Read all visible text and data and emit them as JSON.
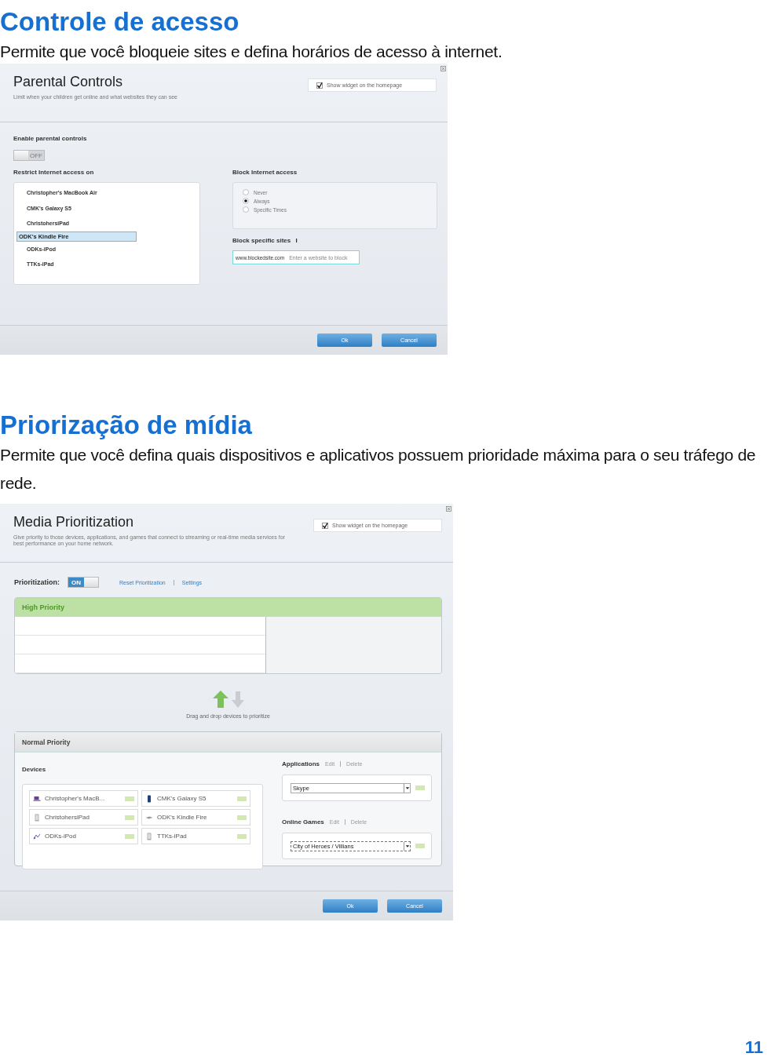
{
  "parental": {
    "heading": "Controle de acesso",
    "description": "Permite que você bloqueie sites e defina horários de acesso à internet.",
    "panel": {
      "title": "Parental Controls",
      "subtitle": "Limit when your children get online and what websites they can see",
      "show_widget": {
        "label": "Show widget on the homepage",
        "checked": true
      },
      "enable_label": "Enable parental controls",
      "toggle": {
        "label": "OFF",
        "on": false
      },
      "restrict_label": "Restrict Internet access on",
      "devices": [
        {
          "name": "Christopher's MacBook Air",
          "selected": false
        },
        {
          "name": "CMK's Galaxy S5",
          "selected": false
        },
        {
          "name": "ChristohersiPad",
          "selected": false
        },
        {
          "name": "ODK's Kindle Fire",
          "selected": true
        },
        {
          "name": "ODKs-iPod",
          "selected": false
        },
        {
          "name": "TTKs-iPad",
          "selected": false
        }
      ],
      "block_label": "Block Internet access",
      "block_options": [
        {
          "label": "Never",
          "selected": false
        },
        {
          "label": "Always",
          "selected": true
        },
        {
          "label": "Specific Times",
          "selected": false
        }
      ],
      "sites_label": "Block specific sites",
      "sites_field": {
        "value": "www.blockedsite.com",
        "placeholder": "Enter a website to block"
      },
      "buttons": [
        "Ok",
        "Cancel"
      ]
    }
  },
  "media": {
    "heading": "Priorização de mídia",
    "description": "Permite que você defina quais dispositivos e aplicativos possuem prioridade máxima para o seu tráfego de rede.",
    "panel": {
      "title": "Media Prioritization",
      "subtitle": "Give priority to those devices, applications, and games that connect to streaming or real-time media services for best performance on your home network.",
      "show_widget": {
        "label": "Show widget on the homepage",
        "checked": true
      },
      "prioritization_label": "Prioritization:",
      "toggle": {
        "label": "ON",
        "on": true
      },
      "links": [
        "Reset Prioritization",
        "Settings"
      ],
      "high_priority": "High Priority",
      "drag_hint": "Drag and drop devices to prioritize",
      "normal_priority": "Normal Priority",
      "devices_label": "Devices",
      "devices": [
        {
          "name": "Christopher's MacB...",
          "kind": "laptop"
        },
        {
          "name": "CMK's Galaxy S5",
          "kind": "phone"
        },
        {
          "name": "ChristohersiPad",
          "kind": "tablet"
        },
        {
          "name": "ODK's Kindle Fire",
          "kind": "reader"
        },
        {
          "name": "ODKs-iPod",
          "kind": "player"
        },
        {
          "name": "TTKs-iPad",
          "kind": "tablet"
        }
      ],
      "applications": {
        "label": "Applications",
        "actions": [
          "Edit",
          "Delete"
        ],
        "value": "Skype"
      },
      "online_games": {
        "label": "Online Games",
        "actions": [
          "Edit",
          "Delete"
        ],
        "value": "City of Heroes / Villians"
      },
      "buttons": [
        "Ok",
        "Cancel"
      ]
    }
  },
  "page_number": "11"
}
